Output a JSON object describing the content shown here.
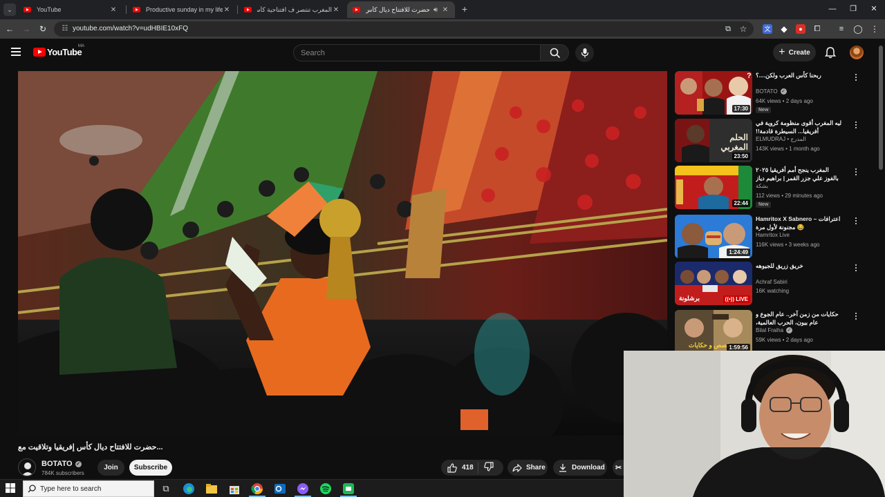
{
  "browser": {
    "tabs": [
      {
        "title": "YouTube",
        "active": false
      },
      {
        "title": "Productive sunday in my life liv",
        "active": false
      },
      {
        "title": "المغرب تنتصر ف افتتاحية كأس الأ",
        "active": false
      },
      {
        "title": "حضرت للافتتاح ديال كأس إفر",
        "active": true
      }
    ],
    "url": "youtube.com/watch?v=udHBIE10xFQ"
  },
  "masthead": {
    "logo_text": "YouTube",
    "country": "MA",
    "search_placeholder": "Search",
    "create_label": "Create"
  },
  "video": {
    "title": "حضرت للافتتاح ديال كأس إفريقيا وتلاقيت مع...",
    "channel": "BOTATO",
    "subscribers": "784K subscribers",
    "join_label": "Join",
    "subscribe_label": "Subscribe",
    "likes": "418",
    "share_label": "Share",
    "download_label": "Download"
  },
  "recommendations": [
    {
      "title": "ربحنا كأس العرب ولكن....؟",
      "channel": "BOTATO",
      "verified": true,
      "meta": "64K views • 2 days ago",
      "duration": "17:30",
      "badge": "New",
      "colors": [
        "#b01818",
        "#f2f2f2",
        "#d9a441"
      ]
    },
    {
      "title": "ليه المغرب أقوى منظومة كروية في أفريقيا... السيطرة قادمة!!",
      "channel": "ELMUDRAJ • المدرج",
      "verified": false,
      "meta": "143K views • 1 month ago",
      "duration": "23:50",
      "badge": "",
      "thumb_text": "الحلم المغربي",
      "colors": [
        "#7a1414",
        "#2e2e2e",
        "#f0e6d2"
      ]
    },
    {
      "title": "المغرب ينجح أمم أفريقيا ٢٠٢٥ بالفوز علي جزر القمر | براهيم دياز يبدع والكعبي ...",
      "channel": "بشكة",
      "verified": false,
      "meta": "112 views • 29 minutes ago",
      "duration": "22:44",
      "badge": "New",
      "colors": [
        "#c21d1d",
        "#1d8a3a",
        "#f4c21b"
      ]
    },
    {
      "title": "Hamritox X Sabnero – اعترافات مجنونة لأول مرة 😂",
      "channel": "Hamritox Live",
      "verified": false,
      "meta": "116K views • 3 weeks ago",
      "duration": "1:24:49",
      "badge": "",
      "colors": [
        "#2c7bd6",
        "#e0b16e",
        "#c0392b"
      ]
    },
    {
      "title": "خريق زريق للجيوهه",
      "channel": "Achraf Sabiri",
      "verified": false,
      "meta": "16K watching",
      "duration": "",
      "live_label": "LIVE",
      "badge": "",
      "thumb_text": "برشلونة",
      "colors": [
        "#1b2a6b",
        "#c21d1d",
        "#e7e7e7"
      ]
    },
    {
      "title": "حكايات من زمن آخر.. عام الجوع و عام بيون، الحرب العالمية، الاستعمار، زواج الفتيه",
      "channel": "Bilal Fraiha",
      "verified": true,
      "meta": "59K views • 2 days ago",
      "duration": "1:59:56",
      "badge": "",
      "thumb_text": "قصص و حكايات",
      "colors": [
        "#5a4a34",
        "#a68a5b",
        "#3a2b1d"
      ]
    }
  ],
  "taskbar": {
    "search_placeholder": "Type here to search"
  }
}
